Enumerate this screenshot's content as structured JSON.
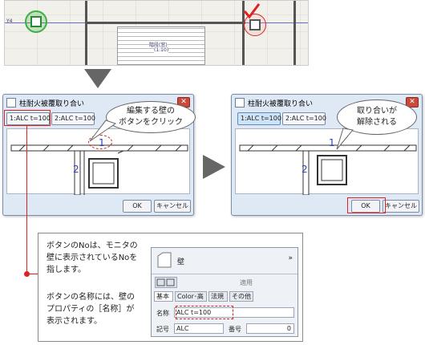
{
  "cad": {
    "label_y4": "Y4",
    "stair_text_1": "階段(窓)",
    "stair_text_2": "(1:10)"
  },
  "dialog_left": {
    "title": "柱耐火被覆取り合い",
    "btn1": "1:ALC t=100",
    "btn2": "2:ALC t=100",
    "wall_no_1": "1",
    "wall_no_2": "2",
    "ok": "OK",
    "cancel": "キャンセル"
  },
  "dialog_right": {
    "title": "柱耐火被覆取り合い",
    "btn1": "1:ALC t=100",
    "btn2": "2:ALC t=100",
    "wall_no_1": "1",
    "wall_no_2": "2",
    "ok": "OK",
    "cancel": "キャンセル"
  },
  "callouts": {
    "left_line1": "編集する壁の",
    "left_line2": "ボタンをクリック",
    "right_line1": "取り合いが",
    "right_line2": "解除される"
  },
  "explanation": {
    "p1_l1": "ボタンのNoは、モニタの",
    "p1_l2": "壁に表示されているNoを",
    "p1_l3": "指します。",
    "p2_l1": "ボタンの名称には、壁の",
    "p2_l2": "プロパティの［名称］が",
    "p2_l3": "表示されます。"
  },
  "panel": {
    "title": "壁",
    "apply": "適用",
    "tabs": [
      "基本",
      "Color･高",
      "法規",
      "その他"
    ],
    "name_label": "名称",
    "name_value": "ALC t=100",
    "code_label": "記号",
    "code_value": "ALC",
    "number_label": "番号",
    "number_value": "0"
  },
  "colors": {
    "accent_red": "#d22222",
    "wall_number_blue": "#2a3fc0",
    "column_green": "#3cb043"
  }
}
